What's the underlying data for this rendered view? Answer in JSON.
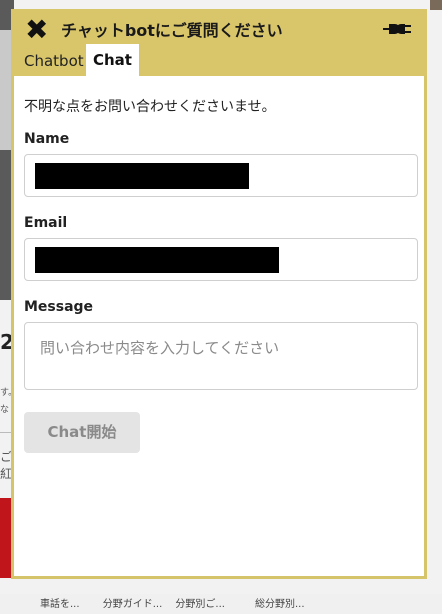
{
  "widget": {
    "title": "チャットbotにご質問ください",
    "tabs": [
      "Chatbot",
      "Chat"
    ],
    "active_tab": "Chat",
    "intro": "不明な点をお問い合わせくださいませ。",
    "name_label": "Name",
    "email_label": "Email",
    "message_label": "Message",
    "message_placeholder": "問い合わせ内容を入力してください",
    "start_button": "Chat開始",
    "accent_color": "#d9c66b"
  },
  "background": {
    "fragment_number": "2",
    "fragment_text_1": "す。",
    "fragment_text_2": "な",
    "fragment_text_3": "ご紅",
    "bottom_bar": "車話を... 　　分野ガイド... 　分野別ご...　　　総分野別..."
  },
  "icons": {
    "close": "close-icon",
    "plug": "plug-icon"
  }
}
